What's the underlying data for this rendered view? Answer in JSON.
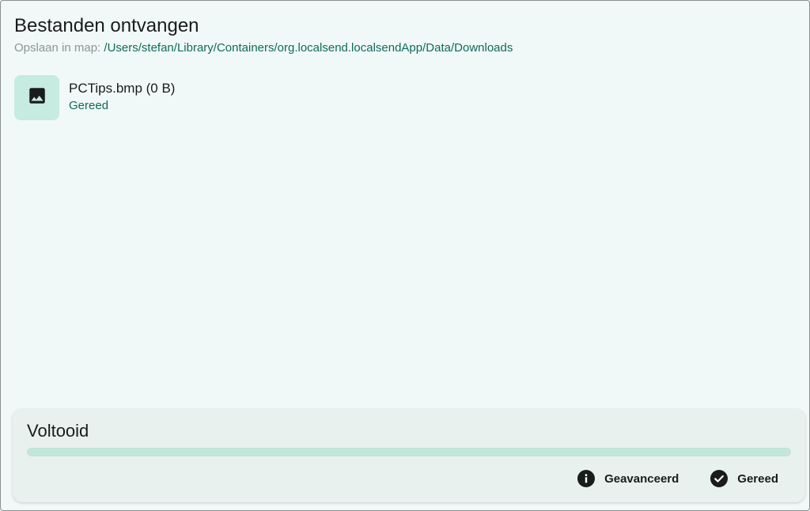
{
  "header": {
    "title": "Bestanden ontvangen",
    "save_label": "Opslaan in map:",
    "save_path": "/Users/stefan/Library/Containers/org.localsend.localsendApp/Data/Downloads"
  },
  "files": [
    {
      "name": "PCTips.bmp (0 B)",
      "status": "Gereed",
      "icon": "image-icon"
    }
  ],
  "progress": {
    "title": "Voltooid",
    "value": 1.0
  },
  "actions": {
    "advanced_label": "Geavanceerd",
    "advanced_icon": "info-icon",
    "done_label": "Gereed",
    "done_icon": "check-circle-icon"
  },
  "colors": {
    "background": "#f0f9f7",
    "accent": "#106a5a",
    "thumb_bg": "#c6ebe0",
    "progress_fill": "#c2e6d9"
  }
}
